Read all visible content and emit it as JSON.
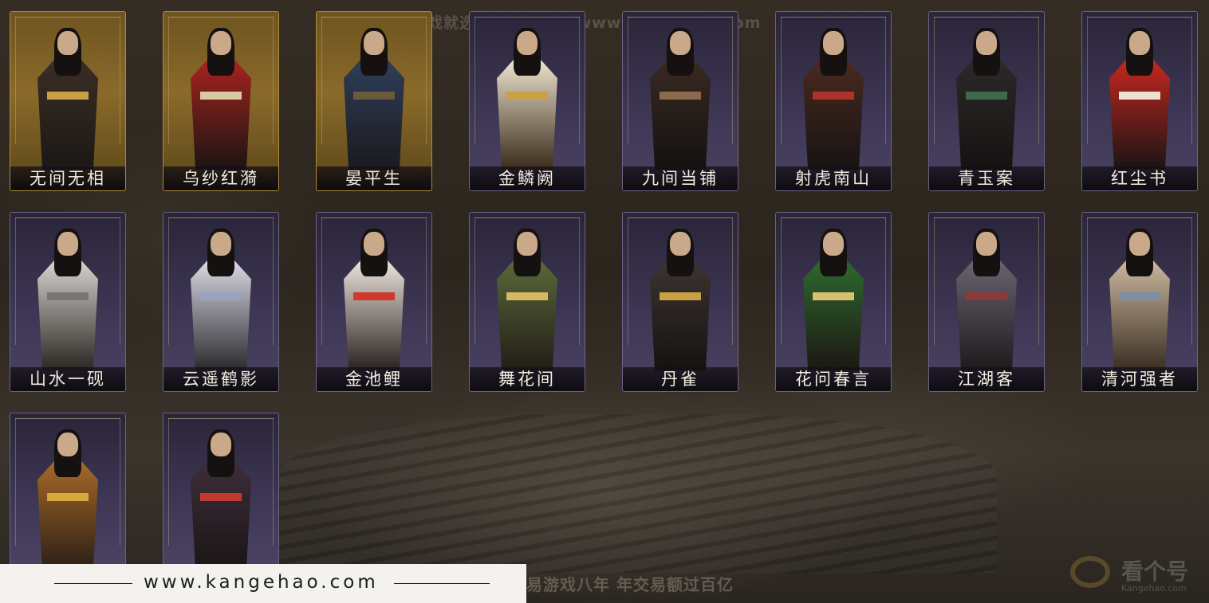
{
  "watermark_top": "网易游戏就选看个号   网址：www.kangehao.com",
  "slogan": "看个号专业网易游戏八年   年交易额过百亿",
  "footer_url": "www.kangehao.com",
  "brand": {
    "name": "看个号",
    "sub": "Kangehao.com"
  },
  "outfits": [
    {
      "name": "无间无相",
      "rarity": "gold"
    },
    {
      "name": "乌纱红漪",
      "rarity": "gold"
    },
    {
      "name": "晏平生",
      "rarity": "gold"
    },
    {
      "name": "金鳞阙",
      "rarity": "purple"
    },
    {
      "name": "九间当铺",
      "rarity": "purple"
    },
    {
      "name": "射虎南山",
      "rarity": "purple"
    },
    {
      "name": "青玉案",
      "rarity": "purple"
    },
    {
      "name": "红尘书",
      "rarity": "purple"
    },
    {
      "name": "山水一砚",
      "rarity": "purple"
    },
    {
      "name": "云遥鹤影",
      "rarity": "purple"
    },
    {
      "name": "金池鲤",
      "rarity": "purple"
    },
    {
      "name": "舞花间",
      "rarity": "purple"
    },
    {
      "name": "丹雀",
      "rarity": "purple"
    },
    {
      "name": "花问春言",
      "rarity": "purple"
    },
    {
      "name": "江湖客",
      "rarity": "purple"
    },
    {
      "name": "清河强者",
      "rarity": "purple"
    },
    {
      "name": "",
      "rarity": "purple"
    },
    {
      "name": "",
      "rarity": "purple"
    }
  ],
  "colors": {
    "gold_card": "#8a6a2a",
    "purple_card": "#3d3654",
    "label_text": "#f3ecdf"
  }
}
